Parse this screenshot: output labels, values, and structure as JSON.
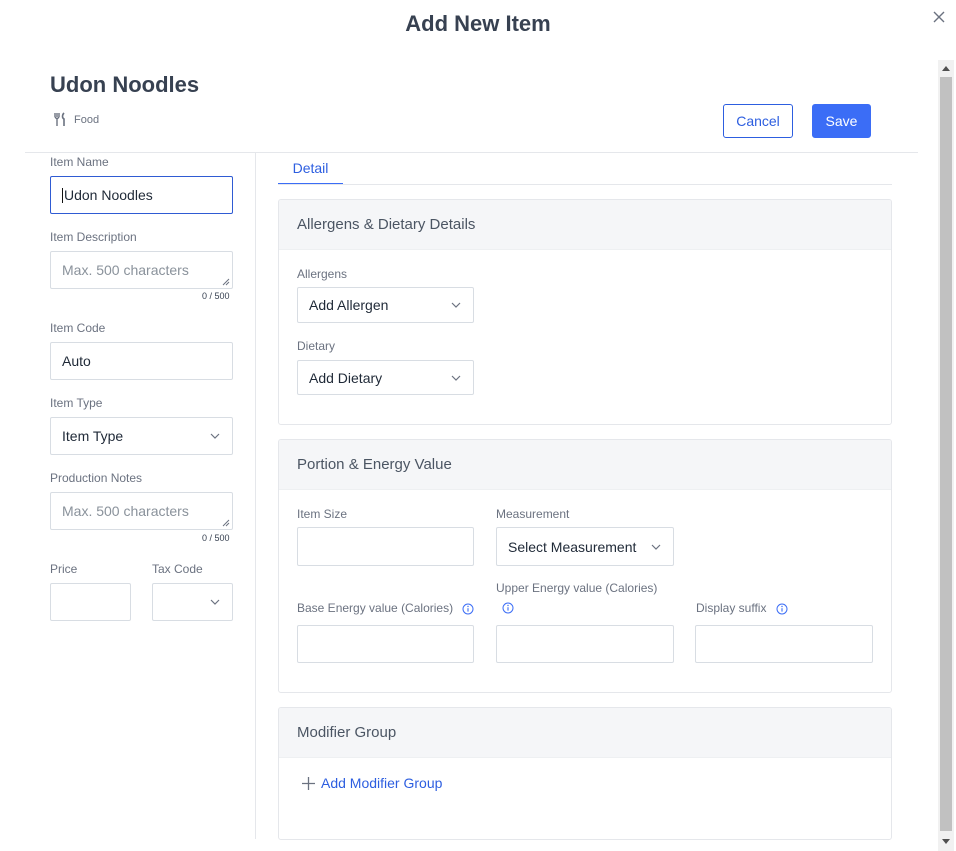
{
  "modal": {
    "title": "Add New Item"
  },
  "item": {
    "name": "Udon Noodles",
    "category": "Food"
  },
  "actions": {
    "cancel": "Cancel",
    "save": "Save"
  },
  "form": {
    "item_name": {
      "label": "Item Name",
      "value": "Udon Noodles"
    },
    "item_description": {
      "label": "Item Description",
      "placeholder": "Max. 500 characters",
      "counter": "0 / 500"
    },
    "item_code": {
      "label": "Item Code",
      "value": "Auto"
    },
    "item_type": {
      "label": "Item Type",
      "value": "Item Type"
    },
    "production_notes": {
      "label": "Production Notes",
      "placeholder": "Max. 500 characters",
      "counter": "0 / 500"
    },
    "price": {
      "label": "Price",
      "value": ""
    },
    "tax_code": {
      "label": "Tax Code",
      "value": ""
    }
  },
  "tabs": [
    {
      "label": "Detail",
      "active": true
    }
  ],
  "allergens_section": {
    "title": "Allergens & Dietary Details",
    "allergens": {
      "label": "Allergens",
      "value": "Add Allergen"
    },
    "dietary": {
      "label": "Dietary",
      "value": "Add Dietary"
    }
  },
  "portion_section": {
    "title": "Portion & Energy Value",
    "item_size": {
      "label": "Item Size",
      "value": ""
    },
    "measurement": {
      "label": "Measurement",
      "value": "Select Measurement"
    },
    "base_energy": {
      "label": "Base Energy value (Calories)",
      "value": ""
    },
    "upper_energy": {
      "label": "Upper Energy value (Calories)",
      "value": ""
    },
    "display_suffix": {
      "label": "Display suffix",
      "value": ""
    }
  },
  "modifier_section": {
    "title": "Modifier Group",
    "add_label": "Add Modifier Group"
  },
  "colors": {
    "primary": "#3b6df6",
    "border": "#d8dde3",
    "section_bg": "#f5f6f8"
  },
  "icons": {
    "close": "close-icon",
    "category": "fork-knife-icon",
    "chevron": "chevron-down-icon",
    "info": "info-circle-icon",
    "plus": "plus-icon"
  }
}
